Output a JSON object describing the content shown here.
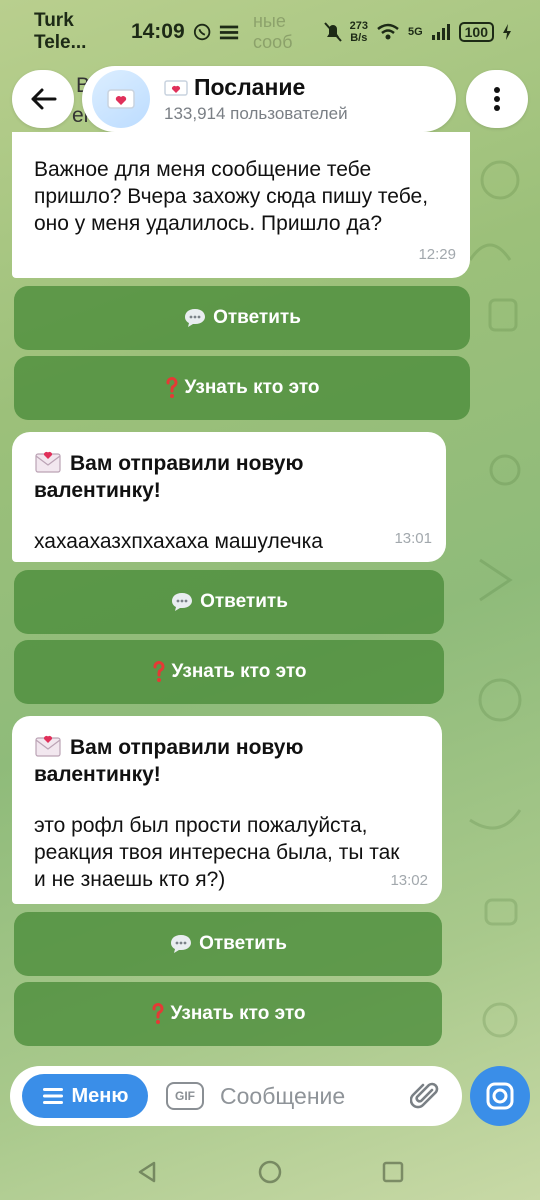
{
  "status_bar": {
    "carrier": "Turk Tele...",
    "time": "14:09",
    "ghost_text": "ные сооб",
    "net_speed_value": "273",
    "net_speed_unit": "B/s",
    "network": "5G",
    "battery": "100"
  },
  "header": {
    "title": "Послание",
    "subscribers": "133,914 пользователей",
    "behind_letter": "В",
    "behind_fragment": "ен"
  },
  "messages": [
    {
      "heading": "",
      "text": "Важное для меня сообщение тебе пришло? Вчера захожу сюда пишу тебе, оно у меня удалилось. Пришло да?",
      "time": "12:29"
    },
    {
      "heading": "Вам отправили новую валентинку!",
      "text": "хахаахазхпхахаха машулечка",
      "time": "13:01"
    },
    {
      "heading": "Вам отправили новую валентинку!",
      "text": "это рофл был прости пожалуйста, реакция твоя интересна была, ты так и не знаешь кто я?)",
      "time": "13:02"
    }
  ],
  "buttons": {
    "reply": "Ответить",
    "who": "Узнать кто это"
  },
  "input": {
    "menu_label": "Меню",
    "gif_label": "GIF",
    "placeholder": "Сообщение"
  },
  "colors": {
    "accent_blue": "#3a8ee8",
    "button_green": "#4a8c3a"
  }
}
